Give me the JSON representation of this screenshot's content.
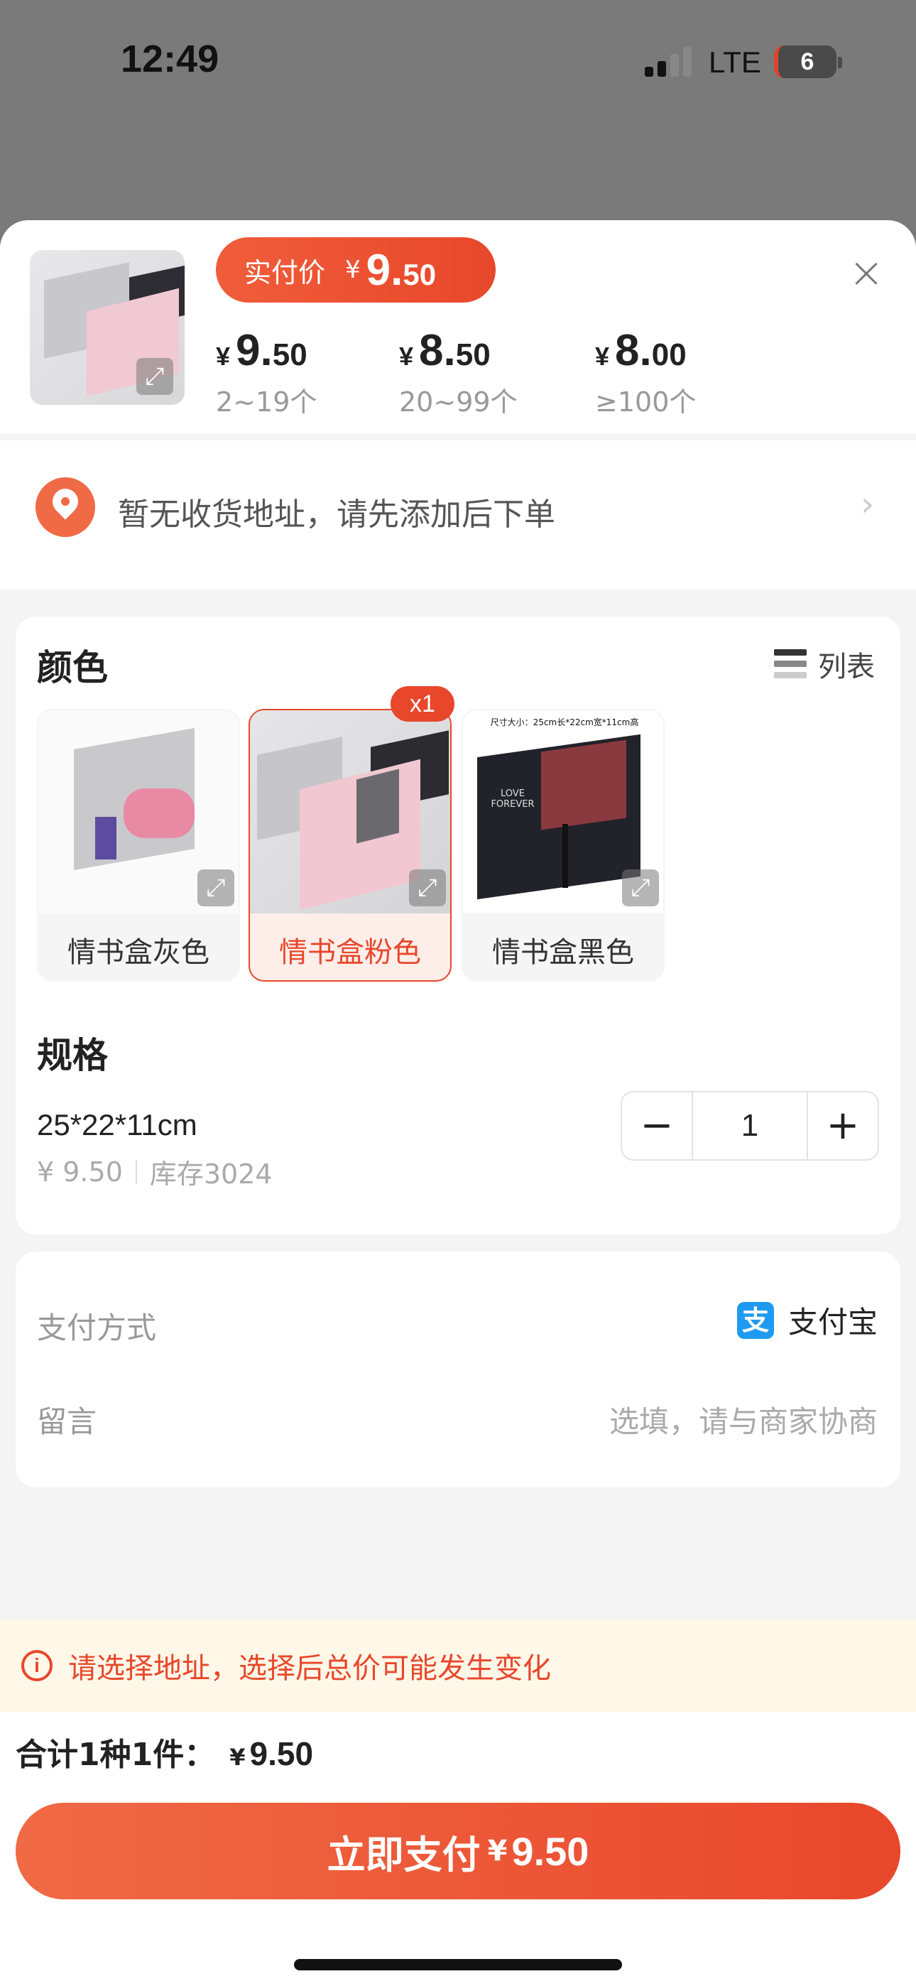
{
  "status_bar": {
    "time": "12:49",
    "network": "LTE",
    "battery": "6"
  },
  "header": {
    "pay_label": "实付价",
    "pay_yen": "¥",
    "pay_int": "9.",
    "pay_dec": "50",
    "tiers": [
      {
        "yen": "¥",
        "int": "9.",
        "dec": "50",
        "range": "2~19个"
      },
      {
        "yen": "¥",
        "int": "8.",
        "dec": "50",
        "range": "20~99个"
      },
      {
        "yen": "¥",
        "int": "8.",
        "dec": "00",
        "range": "≥100个"
      }
    ]
  },
  "address": {
    "text": "暂无收货地址，请先添加后下单"
  },
  "options": {
    "color_title": "颜色",
    "list_toggle": "列表",
    "selected_badge": "x1",
    "variants": [
      {
        "label": "情书盒灰色"
      },
      {
        "label": "情书盒粉色"
      },
      {
        "label": "情书盒黑色"
      }
    ],
    "black_box_caption": "尺寸大小：25cm长*22cm宽*11cm高",
    "black_box_lettering": "LOVE FOREVER",
    "spec_title": "规格",
    "spec_value": "25*22*11cm",
    "spec_price": "¥ 9.50",
    "spec_stock": "库存3024",
    "quantity": "1",
    "minus": "−",
    "plus": "+"
  },
  "payment": {
    "method_label": "支付方式",
    "method_icon": "支",
    "method_value": "支付宝",
    "message_label": "留言",
    "message_placeholder": "选填，请与商家协商"
  },
  "notice": {
    "text": "请选择地址，选择后总价可能发生变化"
  },
  "footer": {
    "total_label": "合计1种1件：",
    "total_yen": "¥",
    "total_amount": "9.50",
    "pay_button_label": "立即支付",
    "pay_button_yen": "¥",
    "pay_button_amount": "9.50"
  },
  "colors": {
    "accent": "#e8472b",
    "accent_light": "#f06a45",
    "notice_bg": "#fff7e8",
    "alipay": "#1e9bf0"
  }
}
